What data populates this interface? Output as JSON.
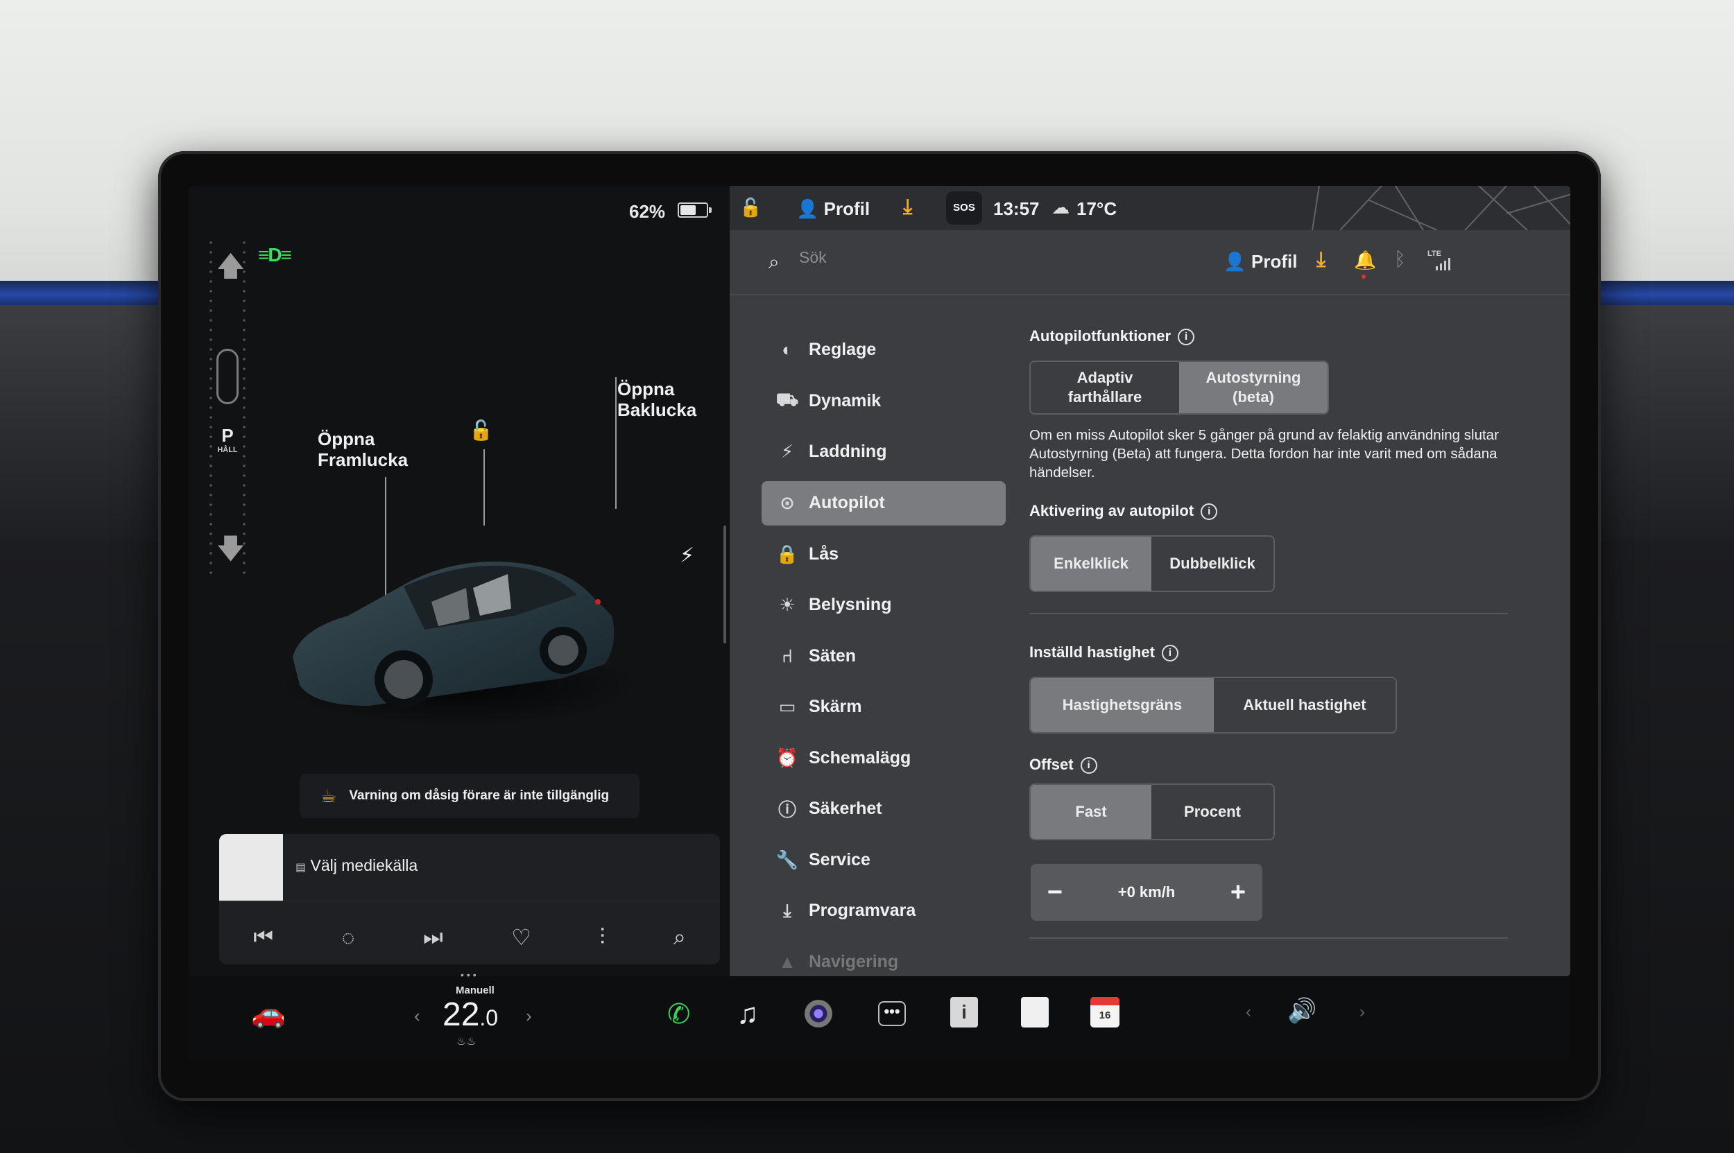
{
  "status": {
    "battery_percent": "62%",
    "battery_level": 0.62,
    "time": "13:57",
    "temperature": "17°C",
    "sos": "SOS"
  },
  "topbar": {
    "profile": "Profil"
  },
  "header": {
    "search_placeholder": "Sök",
    "profile": "Profil",
    "lte": "LTE"
  },
  "car": {
    "gear": "P",
    "gear_sub": "HÅLL",
    "front_trunk": [
      "Öppna",
      "Framlucka"
    ],
    "rear_trunk": [
      "Öppna",
      "Baklucka"
    ],
    "warning": "Varning om dåsig förare är inte tillgänglig"
  },
  "media": {
    "source": "Välj mediekälla"
  },
  "menu": {
    "items": [
      {
        "label": "Reglage",
        "icon": "toggle-icon"
      },
      {
        "label": "Dynamik",
        "icon": "car-front-icon"
      },
      {
        "label": "Laddning",
        "icon": "bolt-icon"
      },
      {
        "label": "Autopilot",
        "icon": "steering-wheel-icon",
        "active": true
      },
      {
        "label": "Lås",
        "icon": "lock-icon"
      },
      {
        "label": "Belysning",
        "icon": "sun-icon"
      },
      {
        "label": "Säten",
        "icon": "seat-icon"
      },
      {
        "label": "Skärm",
        "icon": "display-icon"
      },
      {
        "label": "Schemalägg",
        "icon": "alarm-clock-icon"
      },
      {
        "label": "Säkerhet",
        "icon": "alert-circle-icon"
      },
      {
        "label": "Service",
        "icon": "wrench-icon"
      },
      {
        "label": "Programvara",
        "icon": "download-icon"
      },
      {
        "label": "Navigering",
        "icon": "navigation-icon"
      }
    ]
  },
  "autopilot": {
    "features_title": "Autopilotfunktioner",
    "features_options": [
      "Adaptiv\nfarthållare",
      "Autostyrning\n(beta)"
    ],
    "features_selected": 1,
    "description": "Om en miss Autopilot sker 5 gånger på grund av felaktig användning slutar Autostyrning (Beta) att fungera. Detta fordon har inte varit med om sådana händelser.",
    "activation_title": "Aktivering av autopilot",
    "activation_options": [
      "Enkelklick",
      "Dubbelklick"
    ],
    "activation_selected": 0,
    "speed_title": "Inställd hastighet",
    "speed_options": [
      "Hastighetsgräns",
      "Aktuell hastighet"
    ],
    "speed_selected": 0,
    "offset_title": "Offset",
    "offset_options": [
      "Fast",
      "Procent"
    ],
    "offset_selected": 0,
    "offset_value": "+0 km/h"
  },
  "dock": {
    "climate_mode": "Manuell",
    "temp_int": "22",
    "temp_dec": ".0",
    "calendar_day": "16"
  }
}
